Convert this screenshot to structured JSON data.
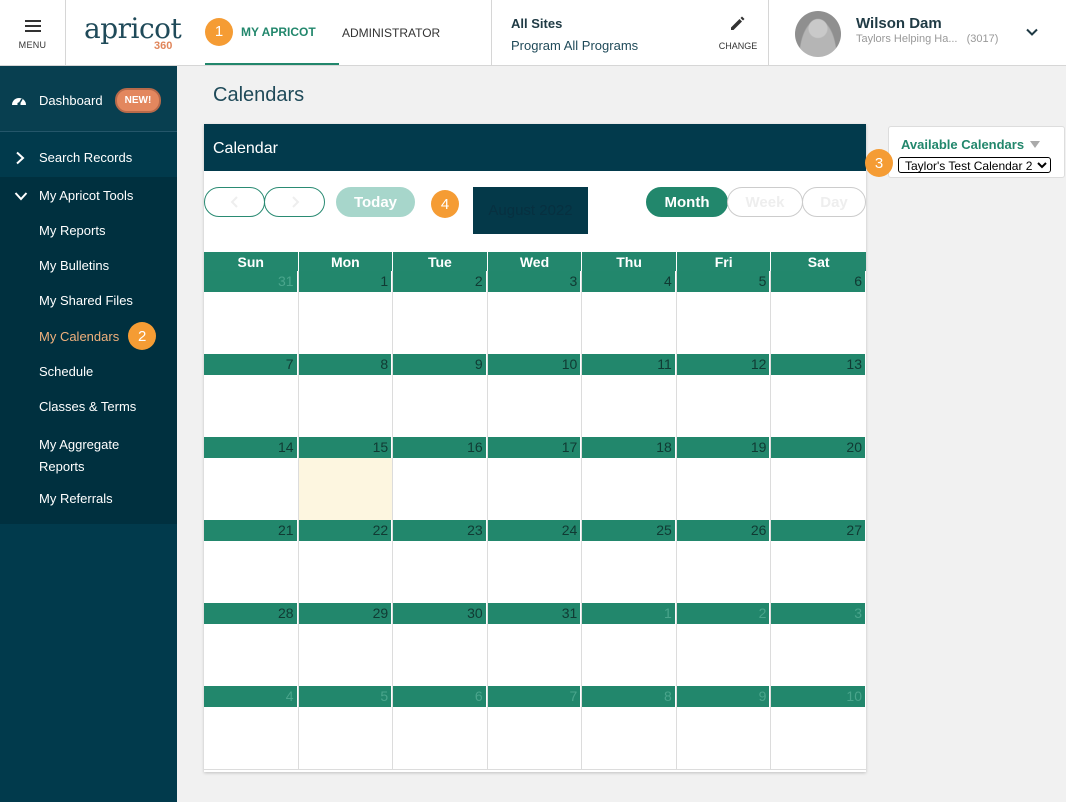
{
  "header": {
    "menu_label": "MENU",
    "logo_word": "apricot",
    "logo_num": "360",
    "tabs": [
      {
        "label": "MY APRICOT",
        "badge": "1"
      },
      {
        "label": "ADMINISTRATOR"
      }
    ],
    "sites_title": "All Sites",
    "program": "Program All Programs",
    "change_label": "CHANGE",
    "user_name": "Wilson Dam",
    "user_org": "Taylors Helping Ha...",
    "user_id": "(3017)"
  },
  "sidebar": {
    "dashboard": "Dashboard",
    "new_badge": "NEW!",
    "search_records": "Search Records",
    "tools_title": "My Apricot Tools",
    "items": [
      {
        "label": "My Reports"
      },
      {
        "label": "My Bulletins"
      },
      {
        "label": "My Shared Files"
      },
      {
        "label": "My Calendars",
        "badge": "2"
      },
      {
        "label": "Schedule"
      },
      {
        "label": "Classes & Terms"
      },
      {
        "label": "My Aggregate"
      },
      {
        "label": "Reports"
      },
      {
        "label": "My Referrals"
      }
    ]
  },
  "main": {
    "title": "Calendars",
    "calendar_title": "Calendar",
    "today_label": "Today",
    "month_badge": "4",
    "month_label": "August 2022",
    "view_month": "Month",
    "view_week": "Week",
    "view_day": "Day",
    "weekdays": [
      "Sun",
      "Mon",
      "Tue",
      "Wed",
      "Thu",
      "Fri",
      "Sat"
    ],
    "weeks": [
      [
        "31",
        "1",
        "2",
        "3",
        "4",
        "5",
        "6"
      ],
      [
        "7",
        "8",
        "9",
        "10",
        "11",
        "12",
        "13"
      ],
      [
        "14",
        "15",
        "16",
        "17",
        "18",
        "19",
        "20"
      ],
      [
        "21",
        "22",
        "23",
        "24",
        "25",
        "26",
        "27"
      ],
      [
        "28",
        "29",
        "30",
        "31",
        "1",
        "2",
        "3"
      ],
      [
        "4",
        "5",
        "6",
        "7",
        "8",
        "9",
        "10"
      ]
    ]
  },
  "available": {
    "title": "Available Calendars",
    "badge": "3",
    "selected": "Taylor's Test Calendar 2"
  },
  "colors": {
    "accent": "#22876c",
    "navy": "#023a4c",
    "badge_orange": "#f59c34",
    "today_highlight": "#fdf6e0"
  }
}
